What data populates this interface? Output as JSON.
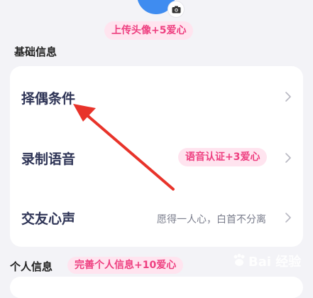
{
  "header": {
    "upload_avatar_pill": "上传头像+5爱心"
  },
  "basic_info": {
    "section_title": "基础信息",
    "rows": [
      {
        "label": "择偶条件"
      },
      {
        "label": "录制语音",
        "pill": "语音认证+3爱心"
      },
      {
        "label": "交友心声",
        "value": "愿得一人心，白首不分离"
      }
    ]
  },
  "personal_info": {
    "section_title": "个人信息",
    "pill": "完善个人信息+10爱心"
  },
  "watermark": {
    "text": "Bai 经验"
  },
  "colors": {
    "accent_pink": "#ee3f80",
    "pill_bg": "#ffe4ef",
    "arrow_red": "#e8332a"
  }
}
